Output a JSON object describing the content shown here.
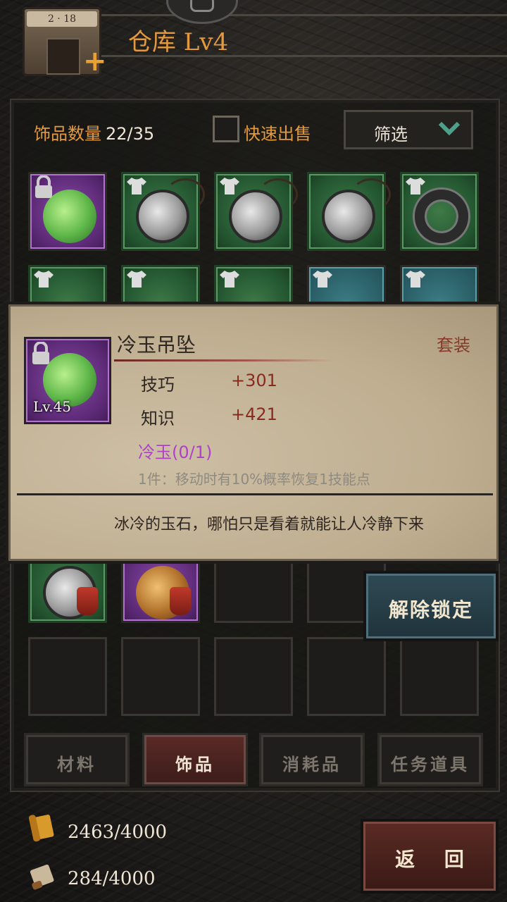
{
  "header": {
    "title": "仓库  Lv4",
    "shop_sign": "2 · 18"
  },
  "toolbar": {
    "count_label": "饰品数量",
    "count_value": "22/35",
    "quick_sell_label": "快速出售",
    "filter_label": "筛选"
  },
  "tooltip": {
    "name": "冷玉吊坠",
    "type": "套装",
    "level": "Lv.45",
    "stats": [
      {
        "name": "技巧",
        "value": "+301"
      },
      {
        "name": "知识",
        "value": "+421"
      }
    ],
    "set_name": "冷玉(0/1)",
    "set_bonus": "1件：移动时有10%概率恢复1技能点",
    "flavor": "冰冷的玉石，哪怕只是看着就能让人冷静下来"
  },
  "buttons": {
    "unlock": "解除锁定",
    "back": "返 回"
  },
  "tabs": [
    {
      "label": "材料",
      "active": false
    },
    {
      "label": "饰品",
      "active": true
    },
    {
      "label": "消耗品",
      "active": false
    },
    {
      "label": "任务道具",
      "active": false
    }
  ],
  "resources": {
    "res1": "2463/4000",
    "res2": "284/4000"
  },
  "colors": {
    "accent_orange": "#e49a3c",
    "set_purple": "#b040c8",
    "stat_red": "#8a2a1e"
  }
}
